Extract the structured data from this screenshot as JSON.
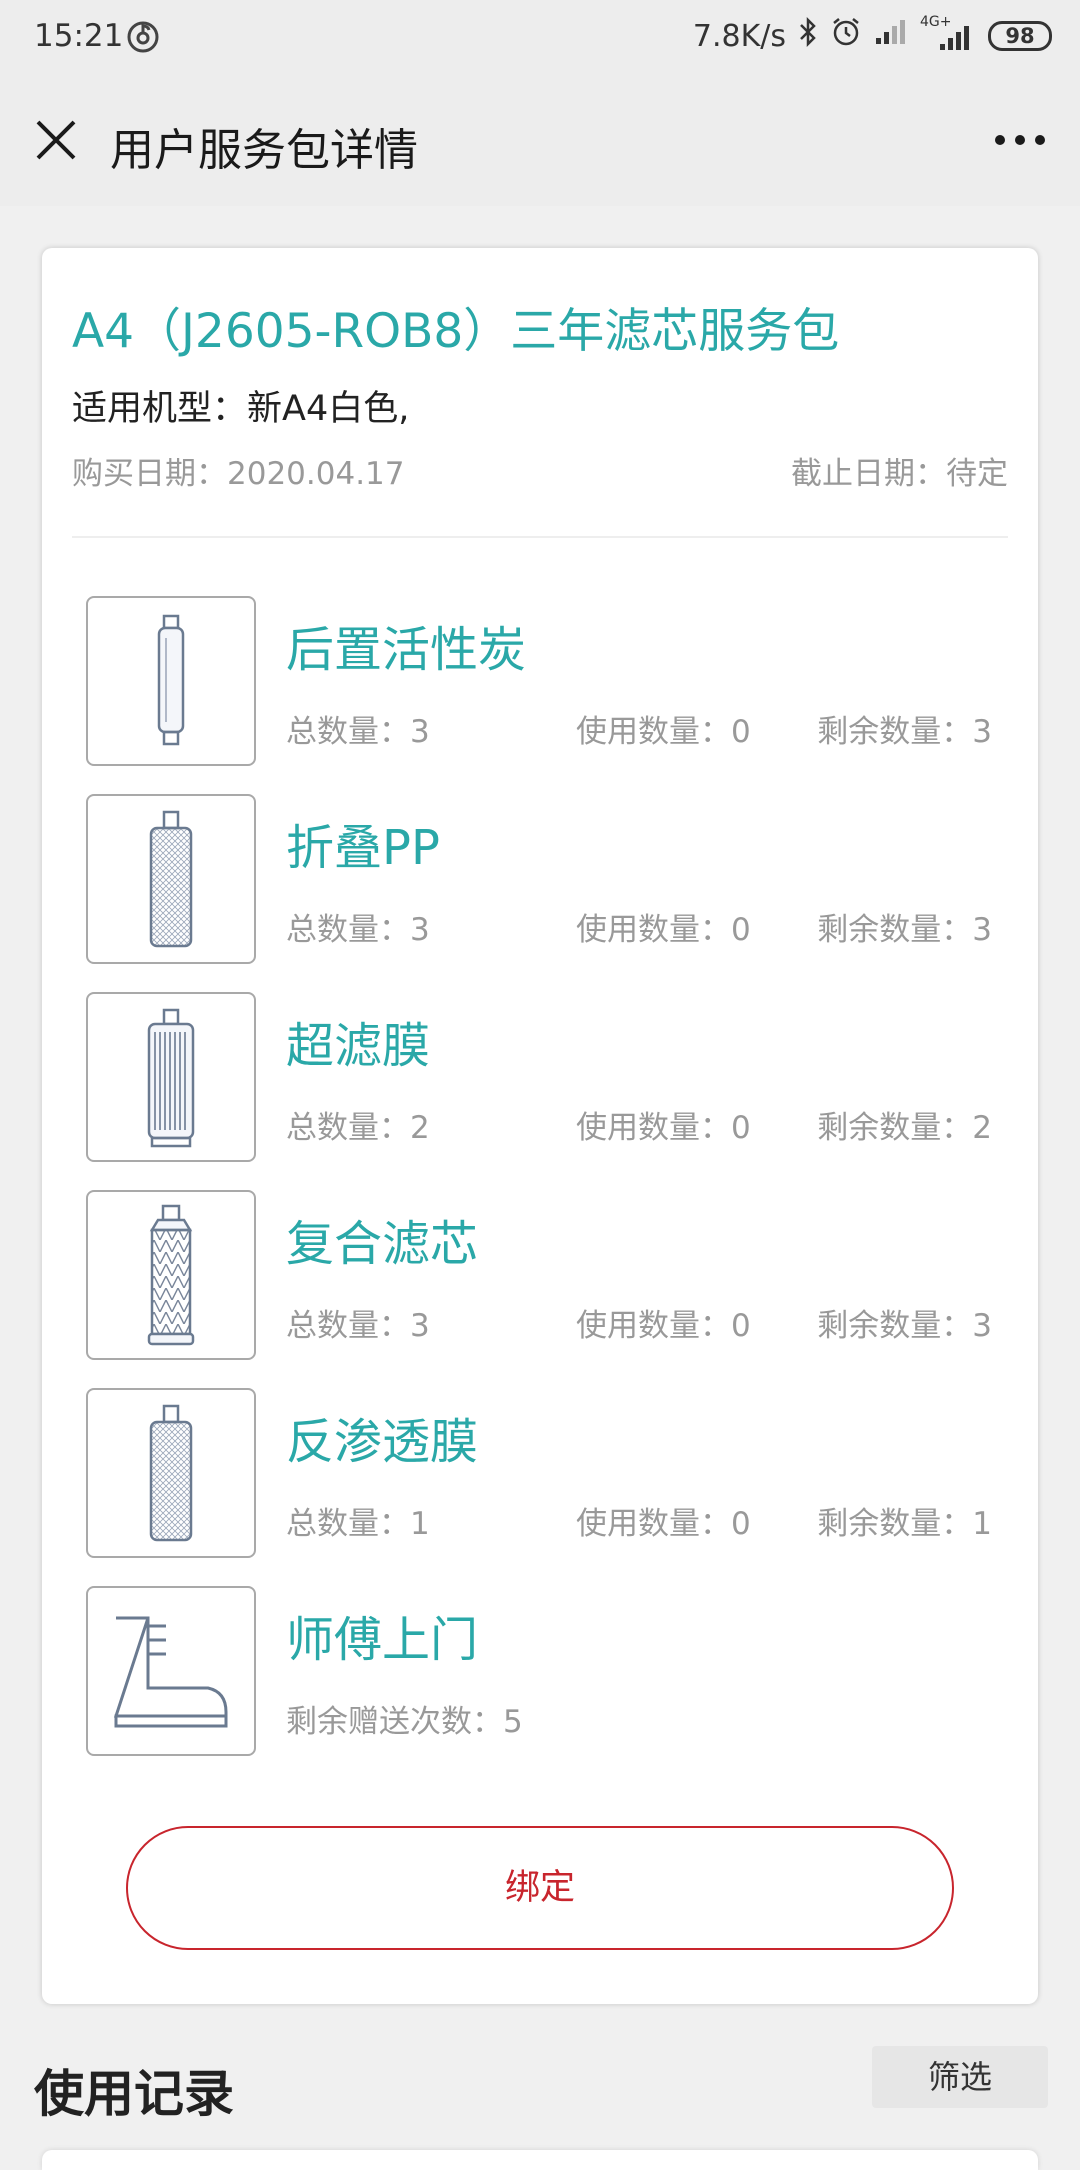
{
  "status_bar": {
    "time": "15:21",
    "speed": "7.8K/s",
    "network": "4G+",
    "battery": "98"
  },
  "header": {
    "title": "用户服务包详情",
    "close_icon": "close-icon",
    "more_icon": "more-icon"
  },
  "package": {
    "title": "A4（J2605-ROB8）三年滤芯服务包",
    "model": "适用机型：新A4白色,",
    "buy_date": "购买日期：2020.04.17",
    "end_date": "截止日期：待定"
  },
  "items": [
    {
      "name": "后置活性炭",
      "total": "总数量：3",
      "used": "使用数量：0",
      "left": "剩余数量：3",
      "icon": "carbon-filter-icon"
    },
    {
      "name": "折叠PP",
      "total": "总数量：3",
      "used": "使用数量：0",
      "left": "剩余数量：3",
      "icon": "pp-filter-icon"
    },
    {
      "name": "超滤膜",
      "total": "总数量：2",
      "used": "使用数量：0",
      "left": "剩余数量：2",
      "icon": "uf-membrane-icon"
    },
    {
      "name": "复合滤芯",
      "total": "总数量：3",
      "used": "使用数量：0",
      "left": "剩余数量：3",
      "icon": "composite-filter-icon"
    },
    {
      "name": "反渗透膜",
      "total": "总数量：1",
      "used": "使用数量：0",
      "left": "剩余数量：1",
      "icon": "ro-membrane-icon"
    },
    {
      "name": "师傅上门",
      "remaining_text": "剩余赠送次数：5",
      "icon": "boot-icon"
    }
  ],
  "bind_button": "绑定",
  "records": {
    "title": "使用记录",
    "filter_label": "筛选"
  },
  "colors": {
    "accent_teal": "#2aa8a8",
    "button_red": "#c8252d",
    "secondary_text": "#999999"
  }
}
